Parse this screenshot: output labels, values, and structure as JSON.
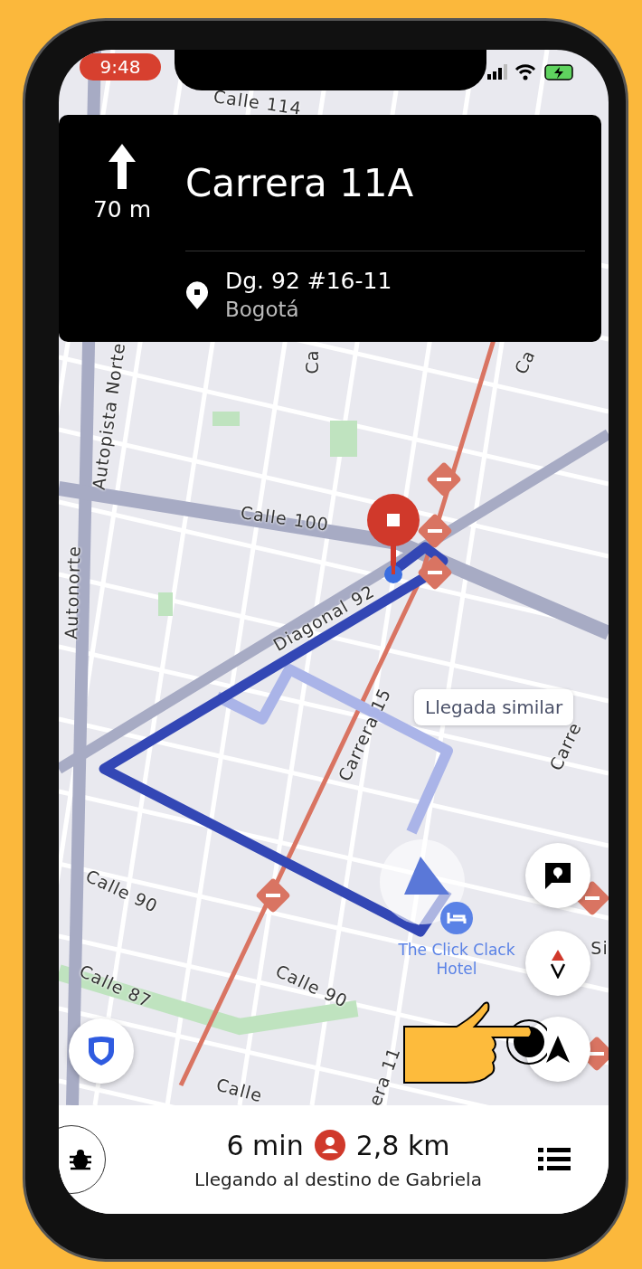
{
  "status_bar": {
    "time": "9:48"
  },
  "maneuver": {
    "distance": "70 m",
    "street": "Carrera 11A",
    "destination": {
      "address": "Dg. 92 #16-11",
      "city": "Bogotá"
    }
  },
  "map": {
    "labels": [
      "Calle 114",
      "Autopista Norte",
      "Autonorte",
      "Calle 100",
      "Diagonal 92",
      "Carrera 15",
      "Calle 90",
      "Calle 87",
      "Calle 90",
      "Ca",
      "Ca",
      "Carre",
      "Si",
      "era 11",
      "Calle"
    ],
    "callout": "Llegada similar",
    "poi": "The Click Clack Hotel"
  },
  "trip": {
    "time": "6 min",
    "distance": "2,8 km",
    "status": "Llegando al destino de Gabriela"
  }
}
